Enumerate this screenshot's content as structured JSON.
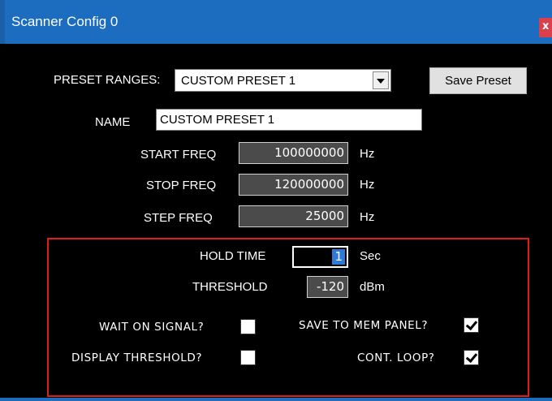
{
  "window": {
    "title": "Scanner Config 0",
    "close_label": "x",
    "colors": {
      "titlebar": "#1c6cbf",
      "background": "#000000",
      "highlight_border": "#e21b1b",
      "selection": "#2f7ad6"
    }
  },
  "preset": {
    "label": "PRESET RANGES:",
    "selected": "CUSTOM PRESET 1",
    "dropdown_icon": "chevron-down-icon",
    "save_button": "Save Preset"
  },
  "name": {
    "label": "NAME",
    "value": "CUSTOM PRESET 1"
  },
  "frequencies": {
    "start": {
      "label": "START FREQ",
      "value": "100000000",
      "unit": "Hz"
    },
    "stop": {
      "label": "STOP FREQ",
      "value": "120000000",
      "unit": "Hz"
    },
    "step": {
      "label": "STEP FREQ",
      "value": "25000",
      "unit": "Hz"
    }
  },
  "scan_options": {
    "hold_time": {
      "label": "HOLD TIME",
      "value": "1",
      "unit": "Sec"
    },
    "threshold": {
      "label": "THRESHOLD",
      "value": "-120",
      "unit": "dBm"
    },
    "wait_on_signal": {
      "label": "WAIT ON SIGNAL?",
      "checked": false
    },
    "save_to_mem_panel": {
      "label": "SAVE TO MEM PANEL?",
      "checked": true
    },
    "display_threshold": {
      "label": "DISPLAY THRESHOLD?",
      "checked": false
    },
    "cont_loop": {
      "label": "CONT. LOOP?",
      "checked": true
    }
  }
}
